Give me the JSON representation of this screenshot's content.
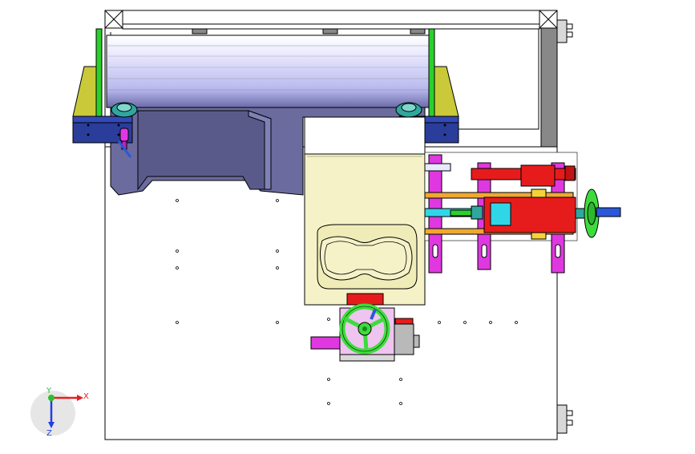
{
  "viewport": {
    "background": "#ffffff",
    "line_color": "#000000"
  },
  "colors": {
    "roller": "#b9b9f0",
    "roller_dark": "#6a6aa8",
    "hopper": "#6b6b9e",
    "tray": "#f5f2c8",
    "yellow_bracket": "#c9c93a",
    "blue_block": "#2a3d9a",
    "green_rail": "#2bd12b",
    "teal_wheel": "#2fa79e",
    "magenta": "#e038e0",
    "red": "#e61c1c",
    "cyan": "#2fd6e8",
    "orange_rod": "#f0a830",
    "handwheel": "#3ddc3d",
    "shaft_blue": "#2a58d8",
    "pink_block": "#efc4ef",
    "grey_block": "#b9b9b9"
  },
  "triad": {
    "x_label": "X",
    "y_label": "Y",
    "z_label": "Z",
    "x_color": "#e62020",
    "y_color": "#2fbf2f",
    "z_color": "#2040e0"
  }
}
